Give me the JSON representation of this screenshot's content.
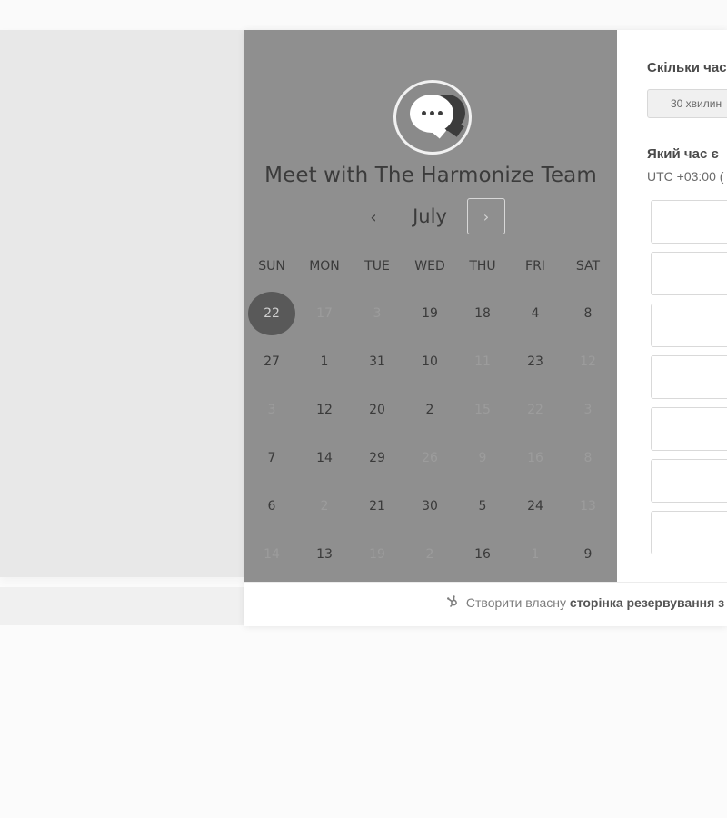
{
  "calendar": {
    "title": "Meet with The Harmonize Team",
    "month": "July",
    "prev_icon": "‹",
    "next_icon": "›",
    "weekdays": [
      "SUN",
      "MON",
      "TUE",
      "WED",
      "THU",
      "FRI",
      "SAT"
    ],
    "days": [
      {
        "label": "22",
        "state": "selected"
      },
      {
        "label": "17",
        "state": "disabled"
      },
      {
        "label": "3",
        "state": "disabled"
      },
      {
        "label": "19",
        "state": "available"
      },
      {
        "label": "18",
        "state": "available"
      },
      {
        "label": "4",
        "state": "available"
      },
      {
        "label": "8",
        "state": "available"
      },
      {
        "label": "27",
        "state": "available"
      },
      {
        "label": "1",
        "state": "available"
      },
      {
        "label": "31",
        "state": "available"
      },
      {
        "label": "10",
        "state": "available"
      },
      {
        "label": "11",
        "state": "disabled"
      },
      {
        "label": "23",
        "state": "available"
      },
      {
        "label": "12",
        "state": "disabled"
      },
      {
        "label": "3",
        "state": "disabled"
      },
      {
        "label": "12",
        "state": "available"
      },
      {
        "label": "20",
        "state": "available"
      },
      {
        "label": "2",
        "state": "available"
      },
      {
        "label": "15",
        "state": "disabled"
      },
      {
        "label": "22",
        "state": "disabled"
      },
      {
        "label": "3",
        "state": "disabled"
      },
      {
        "label": "7",
        "state": "available"
      },
      {
        "label": "14",
        "state": "available"
      },
      {
        "label": "29",
        "state": "available"
      },
      {
        "label": "26",
        "state": "disabled"
      },
      {
        "label": "9",
        "state": "disabled"
      },
      {
        "label": "16",
        "state": "disabled"
      },
      {
        "label": "8",
        "state": "disabled"
      },
      {
        "label": "6",
        "state": "available"
      },
      {
        "label": "2",
        "state": "disabled"
      },
      {
        "label": "21",
        "state": "available"
      },
      {
        "label": "30",
        "state": "available"
      },
      {
        "label": "5",
        "state": "available"
      },
      {
        "label": "24",
        "state": "available"
      },
      {
        "label": "13",
        "state": "disabled"
      },
      {
        "label": "14",
        "state": "disabled"
      },
      {
        "label": "13",
        "state": "available"
      },
      {
        "label": "19",
        "state": "disabled"
      },
      {
        "label": "2",
        "state": "disabled"
      },
      {
        "label": "16",
        "state": "available"
      },
      {
        "label": "1",
        "state": "disabled"
      },
      {
        "label": "9",
        "state": "available"
      }
    ]
  },
  "booking": {
    "duration_question": "Скільки час",
    "duration_option": "30 хвилин",
    "time_question": "Який час є",
    "timezone": "UTC +03:00 (",
    "slot_count": 7
  },
  "footer": {
    "prefix": "Створити власну",
    "bold": "сторінка резервування з"
  },
  "colors": {
    "calendar_bg": "#8f8f8f",
    "selected_day": "#595959"
  }
}
